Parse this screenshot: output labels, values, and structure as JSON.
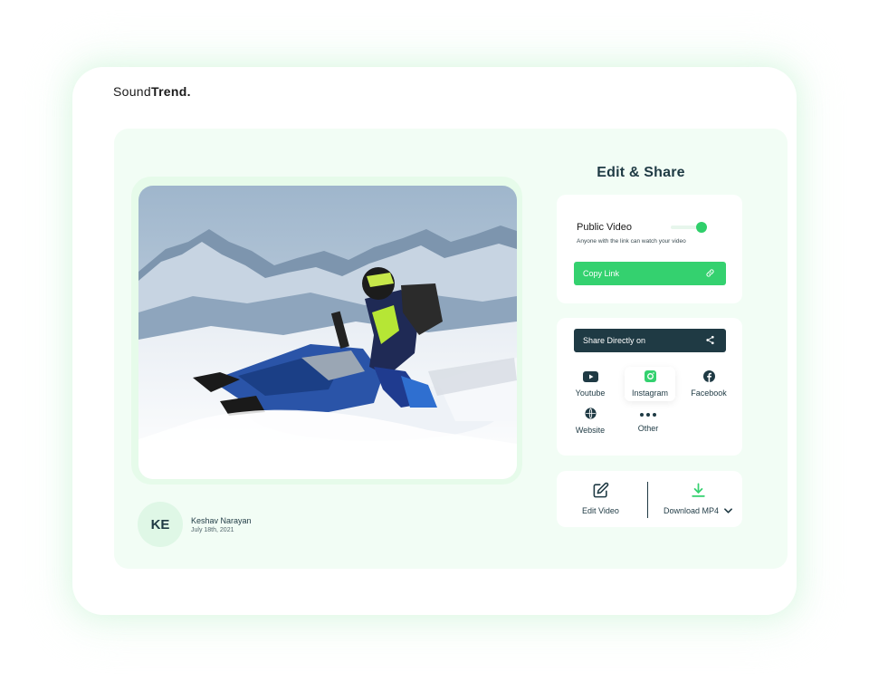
{
  "app": {
    "brand_regular": "Sound",
    "brand_bold": "Trend."
  },
  "video": {
    "alt": "Snowmobile rider on a snowy mountain slope"
  },
  "author": {
    "initials": "KE",
    "name": "Keshav Narayan",
    "date": "July 18th, 2021"
  },
  "share_panel": {
    "title": "Edit & Share",
    "public_video": {
      "label": "Public Video",
      "description": "Anyone with the link can watch your video",
      "enabled": true
    },
    "copy_link_label": "Copy Link",
    "share_directly_label": "Share Directly on",
    "options": [
      {
        "label": "Youtube",
        "icon": "youtube-icon",
        "selected": false
      },
      {
        "label": "Instagram",
        "icon": "instagram-icon",
        "selected": true
      },
      {
        "label": "Facebook",
        "icon": "facebook-icon",
        "selected": false
      },
      {
        "label": "Website",
        "icon": "globe-icon",
        "selected": false
      },
      {
        "label": "Other",
        "icon": "more-dots-icon",
        "selected": false
      }
    ],
    "edit_video_label": "Edit Video",
    "download_label": "Download MP4"
  },
  "colors": {
    "accent_green": "#34d16f",
    "dark_navy": "#1f3a44",
    "panel_bg": "#f2fdf5"
  }
}
